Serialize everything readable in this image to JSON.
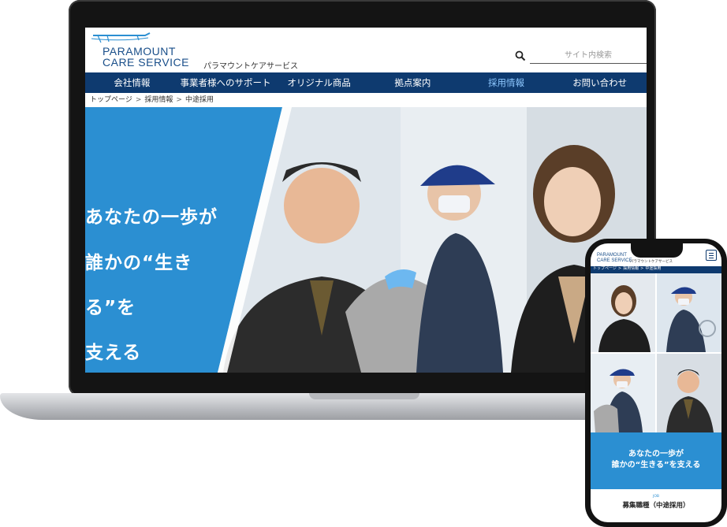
{
  "site": {
    "logo_line1": "PARAMOUNT",
    "logo_line2": "CARE SERVICE",
    "logo_jp": "パラマウントケアサービス",
    "brand_color": "#0e3a6f",
    "accent_color": "#2b8fd2"
  },
  "search": {
    "placeholder": "サイト内検索",
    "icon": "search-icon"
  },
  "nav": {
    "items": [
      {
        "label": "会社情報"
      },
      {
        "label": "事業者様へのサポート"
      },
      {
        "label": "オリジナル商品"
      },
      {
        "label": "拠点案内"
      },
      {
        "label": "採用情報",
        "active": true
      },
      {
        "label": "お問い合わせ"
      }
    ]
  },
  "breadcrumb": {
    "items": [
      "トップページ",
      "採用情報",
      "中途採用"
    ],
    "separator": ">"
  },
  "hero": {
    "lines": [
      "あなたの一歩が",
      "誰かの“生き",
      "る”を",
      "支える"
    ]
  },
  "phone": {
    "breadcrumb": [
      "トップページ",
      "採用情報",
      "中途採用"
    ],
    "hero_line1": "あなたの一歩が",
    "hero_line2": "誰かの“生きる”を支える",
    "section_small": "JOB",
    "section_title": "募集職種（中途採用）"
  }
}
